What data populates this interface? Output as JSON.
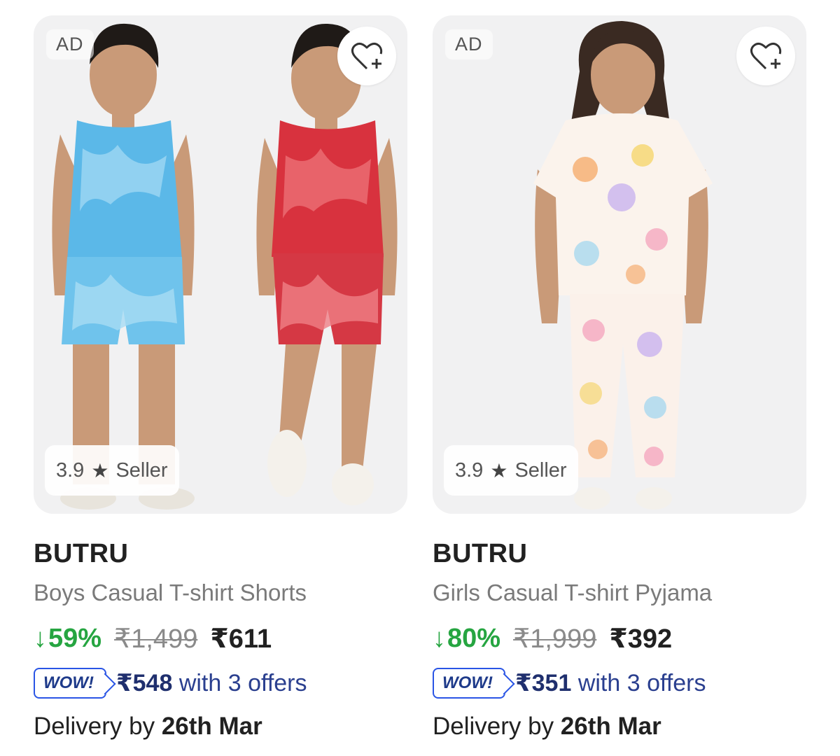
{
  "products": [
    {
      "ad_label": "AD",
      "wishlist_icon": "heart-plus-icon",
      "rating": "3.9",
      "rating_icon": "star-icon",
      "seller_label": "Seller",
      "brand": "BUTRU",
      "title": "Boys Casual T-shirt Shorts",
      "discount": "59%",
      "mrp": "₹1,499",
      "price": "₹611",
      "wow_label": "WOW!",
      "offer_price": "₹548",
      "offer_suffix": "with 3 offers",
      "delivery_prefix": "Delivery by",
      "delivery_date": "26th Mar"
    },
    {
      "ad_label": "AD",
      "wishlist_icon": "heart-plus-icon",
      "rating": "3.9",
      "rating_icon": "star-icon",
      "seller_label": "Seller",
      "brand": "BUTRU",
      "title": "Girls Casual T-shirt Pyjama",
      "discount": "80%",
      "mrp": "₹1,999",
      "price": "₹392",
      "wow_label": "WOW!",
      "offer_price": "₹351",
      "offer_suffix": "with 3 offers",
      "delivery_prefix": "Delivery by",
      "delivery_date": "26th Mar"
    }
  ],
  "colors": {
    "discount_green": "#26a541",
    "offer_blue": "#2a55e5",
    "image_bg": "#f1f1f2"
  }
}
